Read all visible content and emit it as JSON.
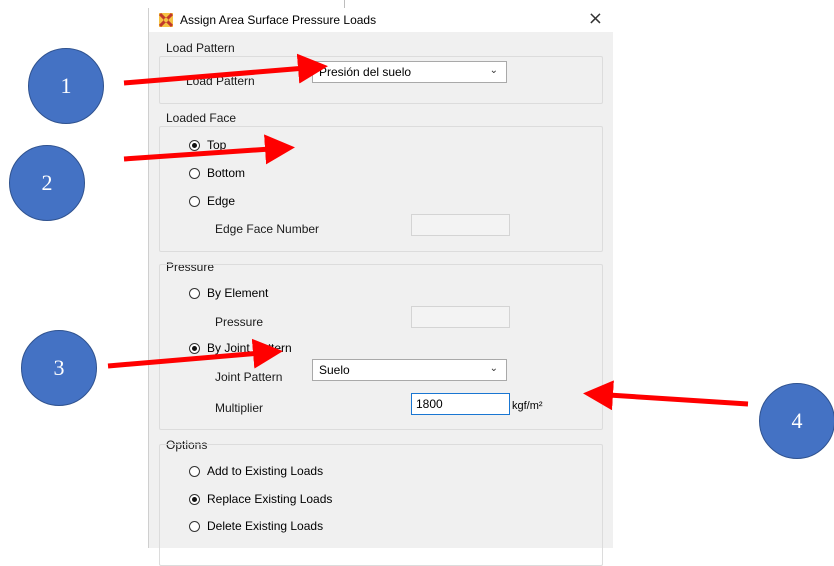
{
  "dialog": {
    "title": "Assign Area Surface Pressure Loads",
    "close_label": "×"
  },
  "load_pattern": {
    "group_label": "Load Pattern",
    "field_label": "Load Pattern",
    "value": "Presión del suelo"
  },
  "loaded_face": {
    "group_label": "Loaded Face",
    "options": [
      {
        "label": "Top",
        "checked": true
      },
      {
        "label": "Bottom",
        "checked": false
      },
      {
        "label": "Edge",
        "checked": false
      }
    ],
    "edge_face_number_label": "Edge Face Number",
    "edge_face_number_value": ""
  },
  "pressure": {
    "group_label": "Pressure",
    "by_element_label": "By Element",
    "by_element_checked": false,
    "pressure_label": "Pressure",
    "pressure_value": "",
    "by_joint_pattern_label": "By Joint Pattern",
    "by_joint_pattern_checked": true,
    "joint_pattern_label": "Joint Pattern",
    "joint_pattern_value": "Suelo",
    "multiplier_label": "Multiplier",
    "multiplier_value": "1800",
    "unit": "kgf/m²"
  },
  "options": {
    "group_label": "Options",
    "items": [
      {
        "label": "Add to Existing Loads",
        "checked": false
      },
      {
        "label": "Replace Existing Loads",
        "checked": true
      },
      {
        "label": "Delete Existing Loads",
        "checked": false
      }
    ]
  },
  "annotations": {
    "labels": [
      "1",
      "2",
      "3",
      "4"
    ],
    "circle_color": "#4472c4",
    "arrow_color": "#ff0000"
  }
}
